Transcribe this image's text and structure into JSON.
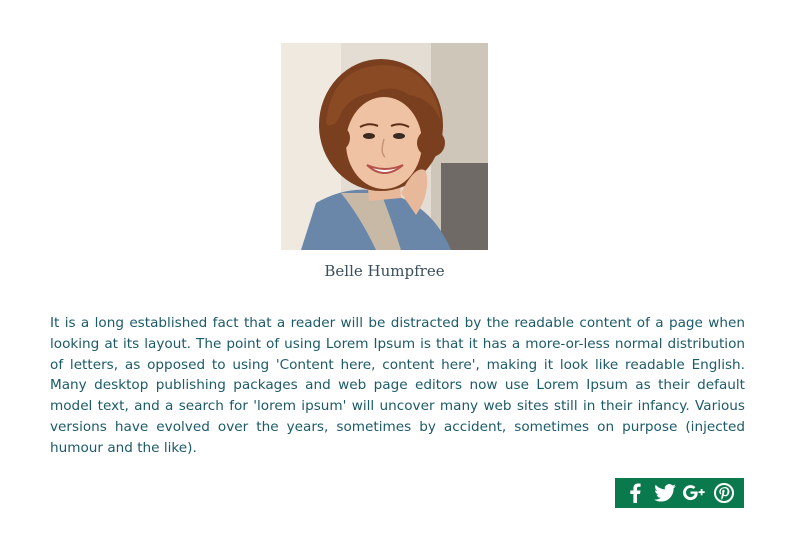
{
  "profile": {
    "name": "Belle Humpfree",
    "avatar_icon": "person-photo",
    "bio": "It is a long established fact that a reader will be distracted by the readable content of a page when looking at its layout. The point of using Lorem Ipsum is that it has a more-or-less normal distribution of letters, as opposed to using 'Content here, content here', making it look like readable English. Many desktop publishing packages and web page editors now use Lorem Ipsum as their default model text, and a search for 'lorem ipsum' will uncover many web sites still in their infancy. Various versions have evolved over the years, sometimes by accident, sometimes on purpose (injected humour and the like)."
  },
  "social": {
    "background_color": "#0a7a4e",
    "icon_color": "#ffffff",
    "icons": [
      "facebook-icon",
      "twitter-icon",
      "google-plus-icon",
      "pinterest-icon"
    ]
  },
  "colors": {
    "text": "#1b5a68",
    "name": "#3a4f5b"
  }
}
